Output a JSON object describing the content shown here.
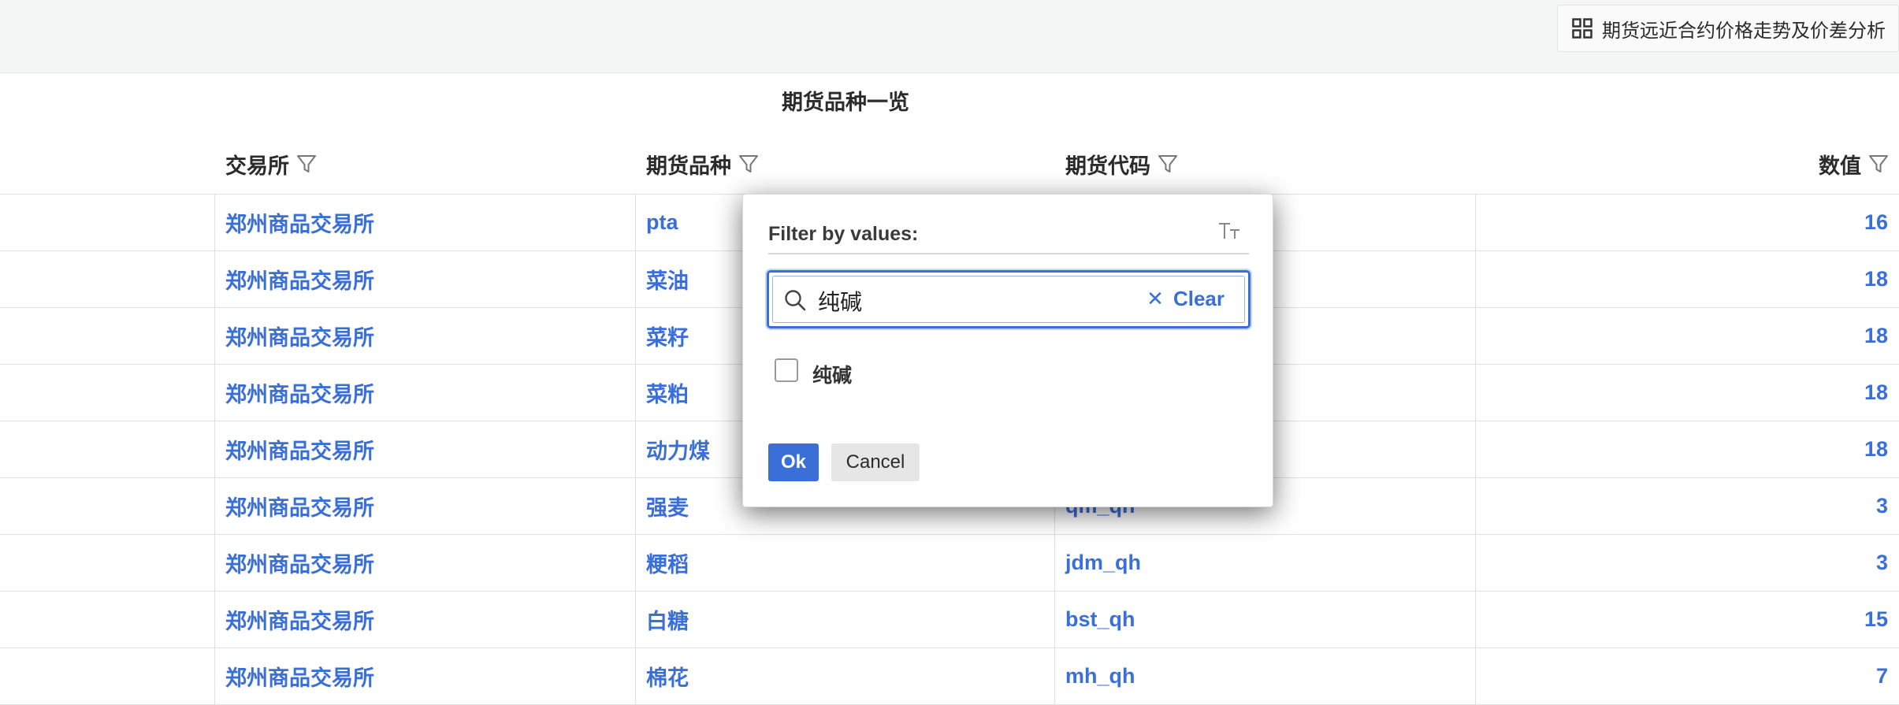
{
  "toolbar": {
    "analysis_button_label": "期货远近合约价格走势及价差分析"
  },
  "table": {
    "title": "期货品种一览",
    "headers": [
      "交易所",
      "期货品种",
      "期货代码",
      "数值"
    ],
    "rows": [
      {
        "exchange": "郑州商品交易所",
        "variety": "pta",
        "code": "",
        "value": "16"
      },
      {
        "exchange": "郑州商品交易所",
        "variety": "菜油",
        "code": "",
        "value": "18"
      },
      {
        "exchange": "郑州商品交易所",
        "variety": "菜籽",
        "code": "",
        "value": "18"
      },
      {
        "exchange": "郑州商品交易所",
        "variety": "菜粕",
        "code": "",
        "value": "18"
      },
      {
        "exchange": "郑州商品交易所",
        "variety": "动力煤",
        "code": "",
        "value": "18"
      },
      {
        "exchange": "郑州商品交易所",
        "variety": "强麦",
        "code": "qm_qh",
        "value": "3"
      },
      {
        "exchange": "郑州商品交易所",
        "variety": "粳稻",
        "code": "jdm_qh",
        "value": "3"
      },
      {
        "exchange": "郑州商品交易所",
        "variety": "白糖",
        "code": "bst_qh",
        "value": "15"
      },
      {
        "exchange": "郑州商品交易所",
        "variety": "棉花",
        "code": "mh_qh",
        "value": "7"
      }
    ]
  },
  "filter_dialog": {
    "label": "Filter by values:",
    "search_value": "纯碱",
    "clear_label": "Clear",
    "options": [
      {
        "label": "纯碱",
        "checked": false
      }
    ],
    "ok_label": "Ok",
    "cancel_label": "Cancel"
  },
  "colors": {
    "accent": "#3a6fd8",
    "link": "#3a6fd8",
    "topbar_bg": "#f4f5f5"
  }
}
